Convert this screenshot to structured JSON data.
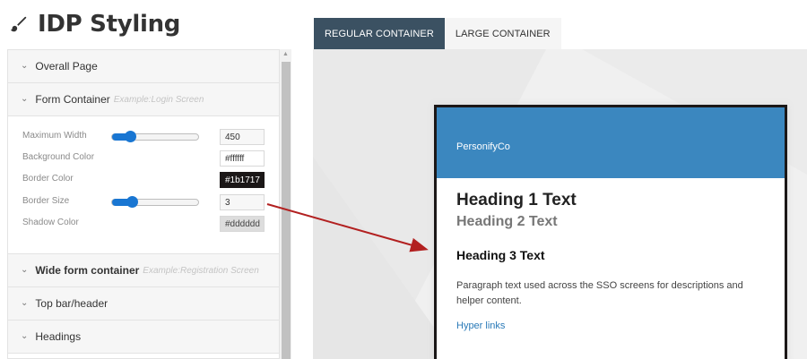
{
  "page": {
    "title": "IDP Styling"
  },
  "accordion": {
    "overall_page": "Overall Page",
    "form_container": {
      "label": "Form Container",
      "example": "Example:Login Screen"
    },
    "fields": {
      "max_width": {
        "label": "Maximum Width",
        "value": "450",
        "slider_fraction": 0.2
      },
      "bg_color": {
        "label": "Background Color",
        "value": "#ffffff"
      },
      "border_color": {
        "label": "Border Color",
        "value": "#1b1717"
      },
      "border_size": {
        "label": "Border Size",
        "value": "3",
        "slider_fraction": 0.22
      },
      "shadow_color": {
        "label": "Shadow Color",
        "value": "#dddddd"
      }
    },
    "wide_form": {
      "label": "Wide form container",
      "example": "Example:Registration Screen"
    },
    "top_bar": "Top bar/header",
    "headings": "Headings"
  },
  "tabs": {
    "regular": "REGULAR CONTAINER",
    "large": "LARGE CONTAINER"
  },
  "preview": {
    "brand": "PersonifyCo",
    "h1": "Heading 1 Text",
    "h2": "Heading 2 Text",
    "h3": "Heading 3 Text",
    "paragraph": "Paragraph text used across the SSO screens for descriptions and helper content.",
    "link": "Hyper links"
  },
  "colors": {
    "accent": "#1976d2",
    "tab_active": "#3b5162",
    "card_header": "#3b87bf",
    "arrow": "#b22020"
  }
}
